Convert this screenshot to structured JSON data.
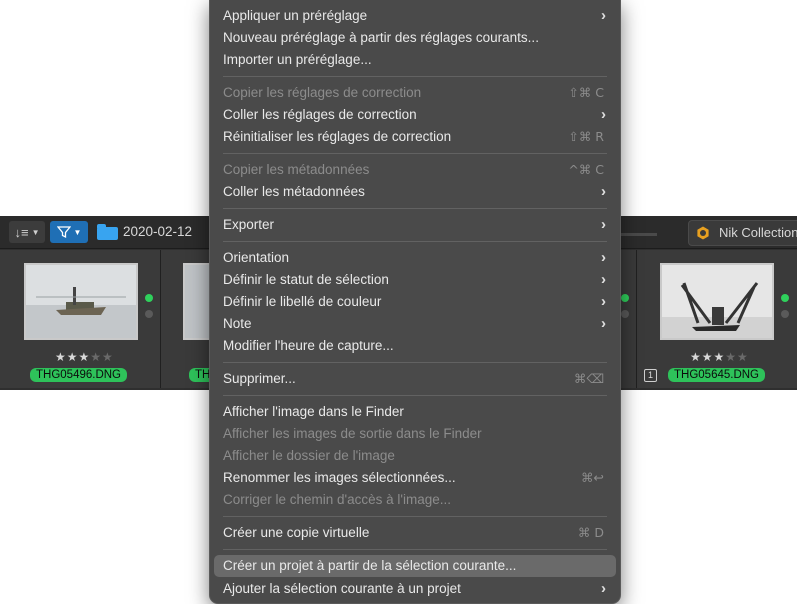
{
  "toolbar": {
    "folder_name": "2020-02-12",
    "nik_label": "Nik Collection"
  },
  "thumbnails": [
    {
      "filename": "THG05496.DNG",
      "stars": "★★★",
      "empty_stars": "★★"
    },
    {
      "filename": "TH"
    },
    {
      "filename": "THG05645.DNG",
      "stars": "★★★",
      "empty_stars": "★★",
      "badge": "1"
    }
  ],
  "menu": {
    "items": [
      {
        "label": "Appliquer un préréglage",
        "shortcut": "",
        "submenu": true,
        "enabled": true
      },
      {
        "label": "Nouveau préréglage à partir des réglages courants...",
        "shortcut": "",
        "submenu": false,
        "enabled": true
      },
      {
        "label": "Importer un préréglage...",
        "shortcut": "",
        "submenu": false,
        "enabled": true
      },
      {
        "label": "Copier les réglages de correction",
        "shortcut": "⇧⌘ C",
        "submenu": false,
        "enabled": false
      },
      {
        "label": "Coller les réglages de correction",
        "shortcut": "",
        "submenu": true,
        "enabled": true
      },
      {
        "label": "Réinitialiser les réglages de correction",
        "shortcut": "⇧⌘ R",
        "submenu": false,
        "enabled": true
      },
      {
        "label": "Copier les métadonnées",
        "shortcut": "^⌘ C",
        "submenu": false,
        "enabled": false
      },
      {
        "label": "Coller les métadonnées",
        "shortcut": "",
        "submenu": true,
        "enabled": true
      },
      {
        "label": "Exporter",
        "shortcut": "",
        "submenu": true,
        "enabled": true
      },
      {
        "label": "Orientation",
        "shortcut": "",
        "submenu": true,
        "enabled": true
      },
      {
        "label": "Définir le statut de sélection",
        "shortcut": "",
        "submenu": true,
        "enabled": true
      },
      {
        "label": "Définir le libellé de couleur",
        "shortcut": "",
        "submenu": true,
        "enabled": true
      },
      {
        "label": "Note",
        "shortcut": "",
        "submenu": true,
        "enabled": true
      },
      {
        "label": "Modifier l'heure de capture...",
        "shortcut": "",
        "submenu": false,
        "enabled": true
      },
      {
        "label": "Supprimer...",
        "shortcut": "⌘⌫",
        "submenu": false,
        "enabled": true
      },
      {
        "label": "Afficher l'image dans le Finder",
        "shortcut": "",
        "submenu": false,
        "enabled": true
      },
      {
        "label": "Afficher les images de sortie dans le Finder",
        "shortcut": "",
        "submenu": false,
        "enabled": false
      },
      {
        "label": "Afficher le dossier de l'image",
        "shortcut": "",
        "submenu": false,
        "enabled": false
      },
      {
        "label": "Renommer les images sélectionnées...",
        "shortcut": "⌘↩",
        "submenu": false,
        "enabled": true
      },
      {
        "label": "Corriger le chemin d'accès à l'image...",
        "shortcut": "",
        "submenu": false,
        "enabled": false
      },
      {
        "label": "Créer une copie virtuelle",
        "shortcut": "⌘ D",
        "submenu": false,
        "enabled": true
      },
      {
        "label": "Créer un projet à partir de la sélection courante...",
        "shortcut": "",
        "submenu": false,
        "enabled": true,
        "highlighted": true
      },
      {
        "label": "Ajouter la sélection courante à un projet",
        "shortcut": "",
        "submenu": true,
        "enabled": true
      }
    ],
    "submenu_arrow": "›"
  }
}
